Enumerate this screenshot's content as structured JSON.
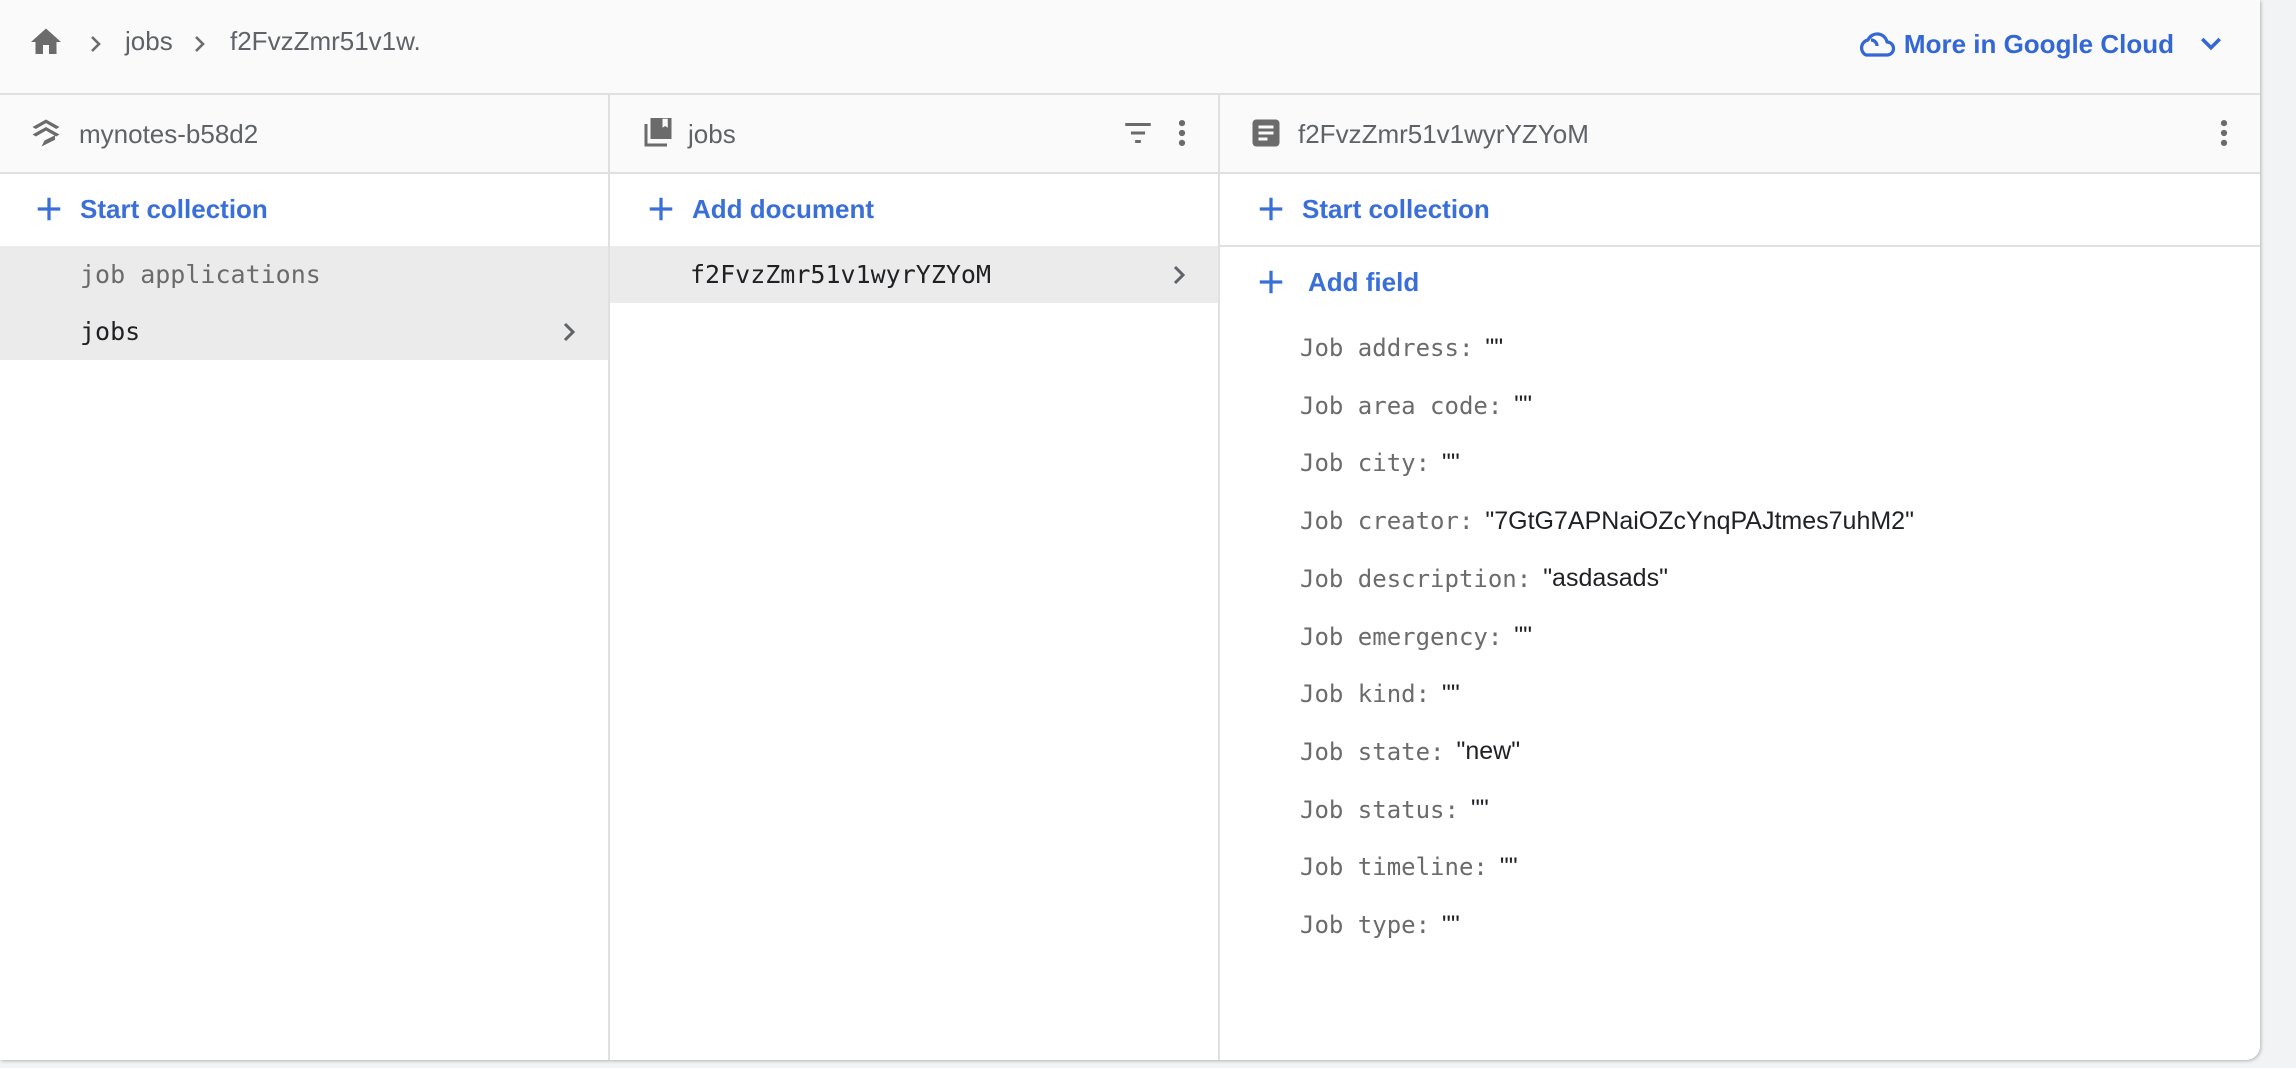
{
  "breadcrumb": {
    "home_icon": "home-icon",
    "items": [
      "jobs",
      "f2FvzZmr51v1w."
    ]
  },
  "cloud_link": {
    "label": "More in Google Cloud",
    "icon": "cloud-icon",
    "accent": "#3367d6"
  },
  "panels": {
    "root": {
      "title": "mynotes-b58d2",
      "icon": "database-stack-icon",
      "action_label": "Start collection",
      "items": [
        {
          "label": "job applications",
          "selected": true
        },
        {
          "label": "jobs",
          "selected": true,
          "chevron": true
        }
      ]
    },
    "collection": {
      "title": "jobs",
      "icon": "collection-icon",
      "action_label": "Add document",
      "items": [
        {
          "label": "f2FvzZmr51v1wyrYZYoM",
          "selected": true,
          "chevron": true
        }
      ]
    },
    "document": {
      "title": "f2FvzZmr51v1wyrYZYoM",
      "icon": "document-icon",
      "start_collection_label": "Start collection",
      "add_field_label": "Add field",
      "fields": [
        {
          "key": "Job address:",
          "value": "\"\""
        },
        {
          "key": "Job area code:",
          "value": "\"\""
        },
        {
          "key": "Job city:",
          "value": "\"\""
        },
        {
          "key": "Job creator:",
          "value": "\"7GtG7APNaiOZcYnqPAJtmes7uhM2\""
        },
        {
          "key": "Job description:",
          "value": "\"asdasads\""
        },
        {
          "key": "Job emergency:",
          "value": "\"\""
        },
        {
          "key": "Job kind:",
          "value": "\"\""
        },
        {
          "key": "Job state:",
          "value": "\"new\""
        },
        {
          "key": "Job status:",
          "value": "\"\""
        },
        {
          "key": "Job timeline:",
          "value": "\"\""
        },
        {
          "key": "Job type:",
          "value": "\"\""
        }
      ]
    }
  }
}
